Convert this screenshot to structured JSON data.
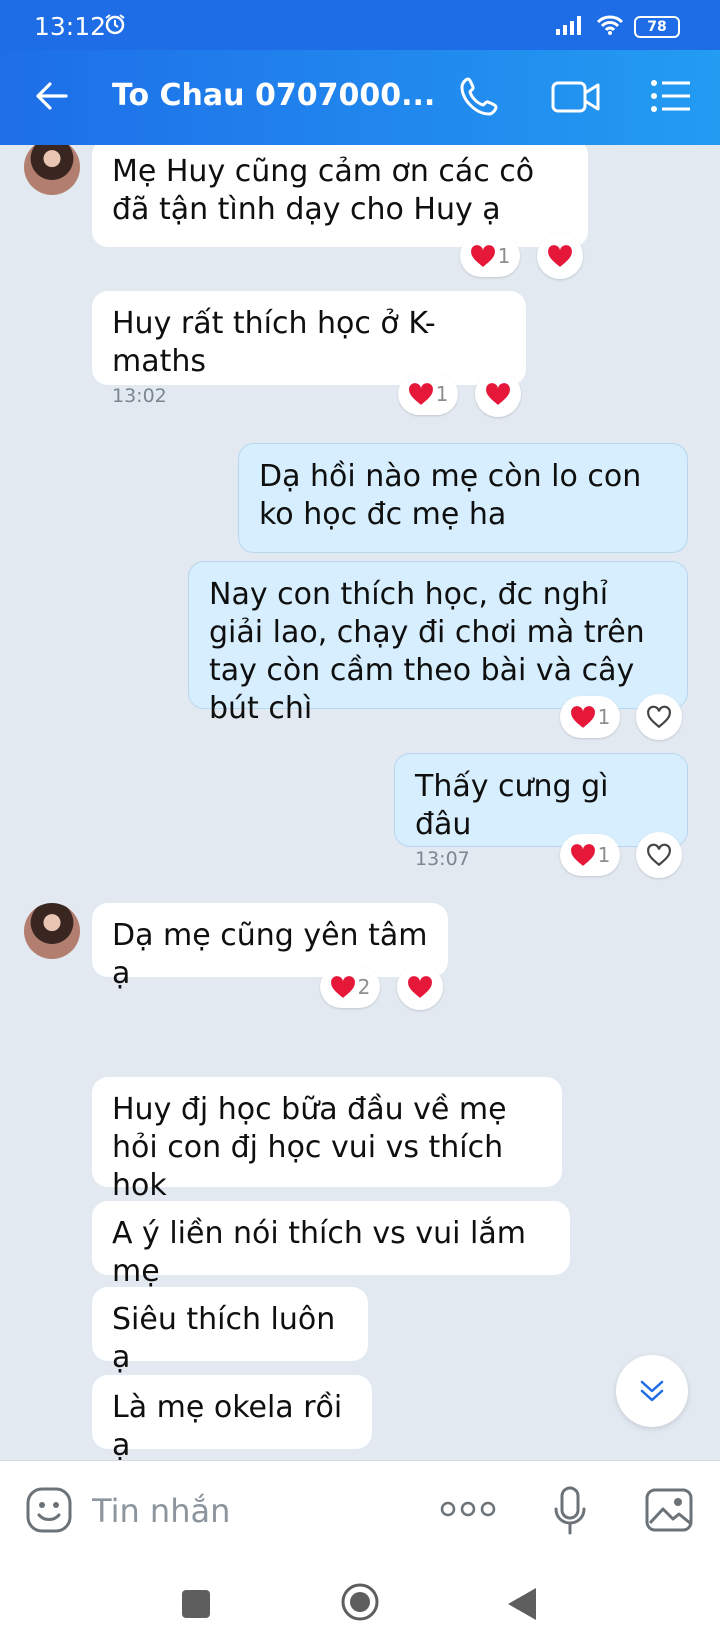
{
  "status_bar": {
    "time": "13:12",
    "battery": "78"
  },
  "header": {
    "title": "To Chau 0707000..."
  },
  "messages": [
    {
      "direction": "in",
      "text": "Mẹ Huy cũng cảm ơn các cô đã tận tình dạy cho Huy ạ",
      "reaction_count": "1"
    },
    {
      "direction": "in",
      "text": "Huy rất thích học ở K-maths",
      "time": "13:02",
      "reaction_count": "1"
    },
    {
      "direction": "out",
      "text": "Dạ hồi nào mẹ còn lo con ko học đc mẹ ha"
    },
    {
      "direction": "out",
      "text": "Nay con thích học, đc nghỉ giải lao, chạy đi chơi mà trên tay còn cầm theo bài và cây bút chì",
      "reaction_count": "1"
    },
    {
      "direction": "out",
      "text": "Thấy cưng gì đâu",
      "time": "13:07",
      "reaction_count": "1"
    },
    {
      "direction": "in",
      "text": "Dạ mẹ cũng yên tâm ạ",
      "reaction_count": "2"
    },
    {
      "direction": "in",
      "text": "Huy đj học bữa đầu về mẹ hỏi con đj học vui vs thích hok"
    },
    {
      "direction": "in",
      "text": "A ý liền nói thích vs vui lắm mẹ"
    },
    {
      "direction": "in",
      "text": "Siêu thích luôn ạ"
    },
    {
      "direction": "in",
      "text": "Là mẹ okela rồi ạ"
    }
  ],
  "input": {
    "placeholder": "Tin nhắn"
  },
  "colors": {
    "header_start": "#1e6ee8",
    "header_end": "#239cf2",
    "outgoing_bubble": "#d6eefd",
    "incoming_bubble": "#ffffff",
    "chat_background": "#e2e9f1",
    "heart": "#e5183a"
  },
  "icons": [
    "back-arrow-icon",
    "phone-icon",
    "video-camera-icon",
    "list-menu-icon",
    "heart-icon",
    "heart-outline-icon",
    "chevron-double-down-icon",
    "sticker-icon",
    "more-dots-icon",
    "microphone-icon",
    "image-icon"
  ]
}
